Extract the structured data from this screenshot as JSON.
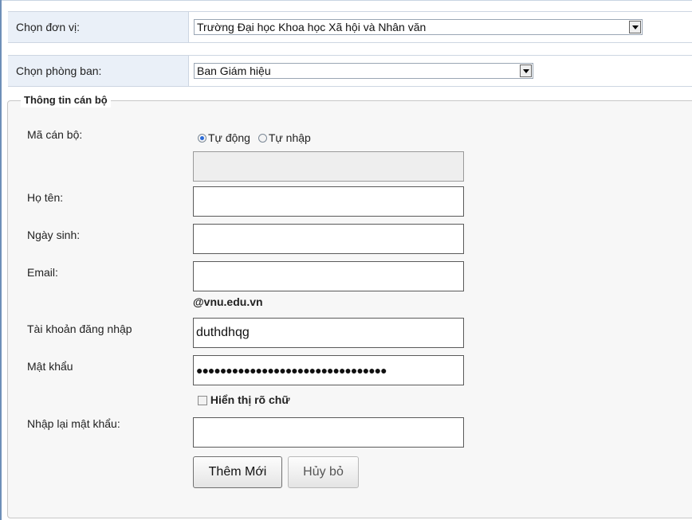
{
  "unit_row": {
    "label": "Chọn đơn vị:",
    "selected": "Trường Đại học Khoa học Xã hội và Nhân văn"
  },
  "dept_row": {
    "label": "Chọn phòng ban:",
    "selected": "Ban Giám hiệu"
  },
  "staff_info": {
    "legend": "Thông tin cán bộ",
    "staff_code": {
      "label": "Mã cán bộ:",
      "option_auto": "Tự động",
      "option_manual": "Tự nhập",
      "selected_option": "Tự động",
      "value": ""
    },
    "full_name": {
      "label": "Họ tên:",
      "value": ""
    },
    "birth_date": {
      "label": "Ngày sinh:",
      "value": ""
    },
    "email": {
      "label": "Email:",
      "value": "",
      "suffix": "@vnu.edu.vn"
    },
    "username": {
      "label": "Tài khoản đăng nhập",
      "value": "duthdhqg"
    },
    "password": {
      "label": "Mật khẩu",
      "value_masked": "●●●●●●●●●●●●●●●●●●●●●●●●●●●●●●●●"
    },
    "show_password": {
      "label": "Hiển thị rõ chữ",
      "checked": false
    },
    "confirm_password": {
      "label": "Nhập lại mật khẩu:",
      "value": ""
    }
  },
  "actions": {
    "add_label": "Thêm Mới",
    "cancel_label": "Hủy bỏ"
  }
}
